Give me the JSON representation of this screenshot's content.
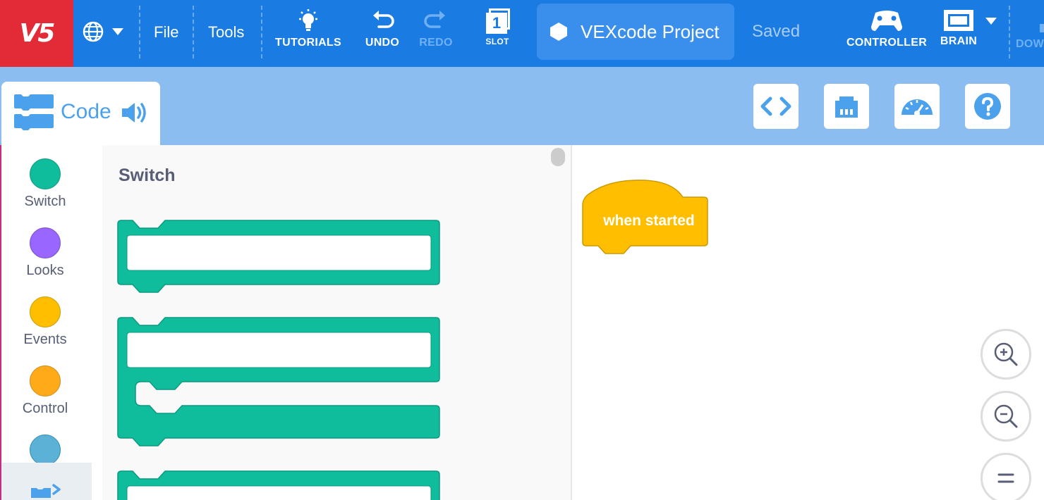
{
  "header": {
    "logo": "V5",
    "menu": {
      "file": "File",
      "tools": "Tools"
    },
    "tutorials": "TUTORIALS",
    "undo": "UNDO",
    "redo": "REDO",
    "slot": {
      "number": "1",
      "label": "SLOT"
    },
    "project_name": "VEXcode Project",
    "save_status": "Saved",
    "controller": "CONTROLLER",
    "brain": "BRAIN",
    "download": "DOW",
    "colors": {
      "bar": "#1a7be3",
      "logo": "#e22b37",
      "project_bg": "#3b8fec"
    }
  },
  "tabs": {
    "code": "Code"
  },
  "toolbar_icons": [
    "code-view-icon",
    "devices-icon",
    "dashboard-icon",
    "help-icon"
  ],
  "categories": [
    {
      "name": "Switch",
      "color": "#0fbd9c"
    },
    {
      "name": "Looks",
      "color": "#9966ff"
    },
    {
      "name": "Events",
      "color": "#ffbf00"
    },
    {
      "name": "Control",
      "color": "#ffab19"
    },
    {
      "name": "",
      "color": "#5cb1d6"
    }
  ],
  "flyout": {
    "title": "Switch",
    "block_color": "#0fbd9c"
  },
  "workspace": {
    "hat_block": "when started",
    "hat_color": "#ffbf00"
  }
}
